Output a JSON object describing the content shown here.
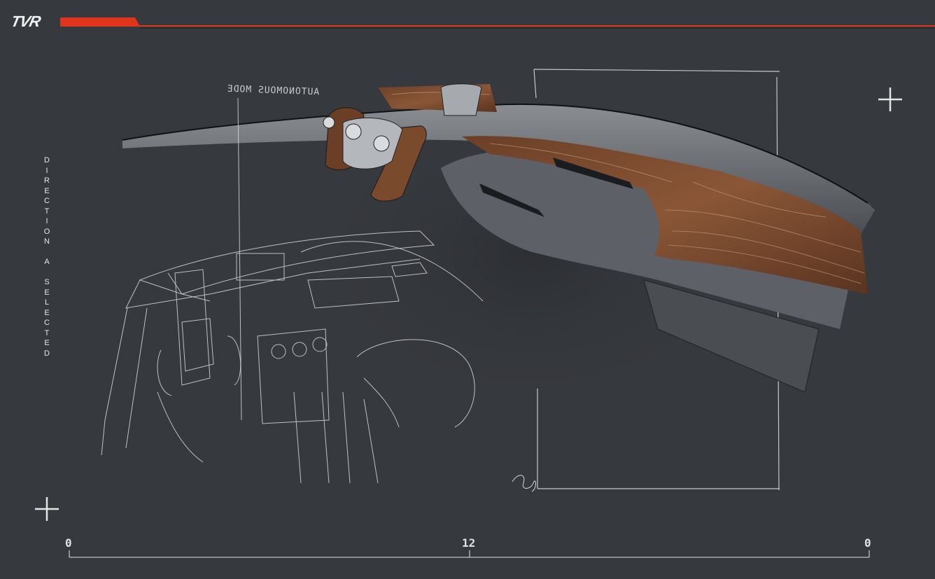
{
  "brand": {
    "logo_text": "TVR",
    "accent_color": "#e0341c"
  },
  "side_label": {
    "text": "DIRECTION A SELECTED"
  },
  "sketch_note": {
    "text": "AUTONOMOUS MODE"
  },
  "timeline": {
    "start_label": "0",
    "mid_label": "12",
    "end_label": "0"
  },
  "icons": [
    "plus-icon",
    "plus-icon"
  ]
}
